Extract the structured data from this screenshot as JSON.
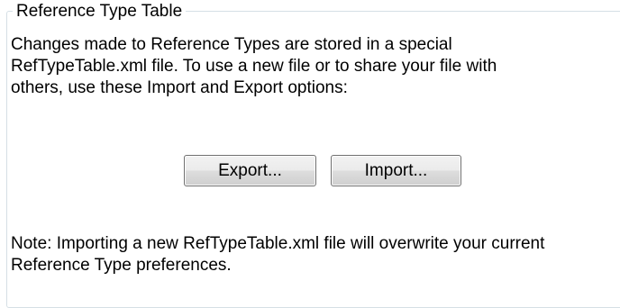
{
  "group": {
    "title": "Reference Type Table"
  },
  "description": {
    "line1": "Changes made to Reference Types are stored in a special",
    "line2": "RefTypeTable.xml file.  To use a new file or to share your file with",
    "line3": "others, use these Import and Export options:"
  },
  "buttons": {
    "export_label": "Export...",
    "import_label": "Import..."
  },
  "note": {
    "line1": "Note: Importing a new RefTypeTable.xml file will overwrite your current",
    "line2": "Reference Type preferences."
  }
}
